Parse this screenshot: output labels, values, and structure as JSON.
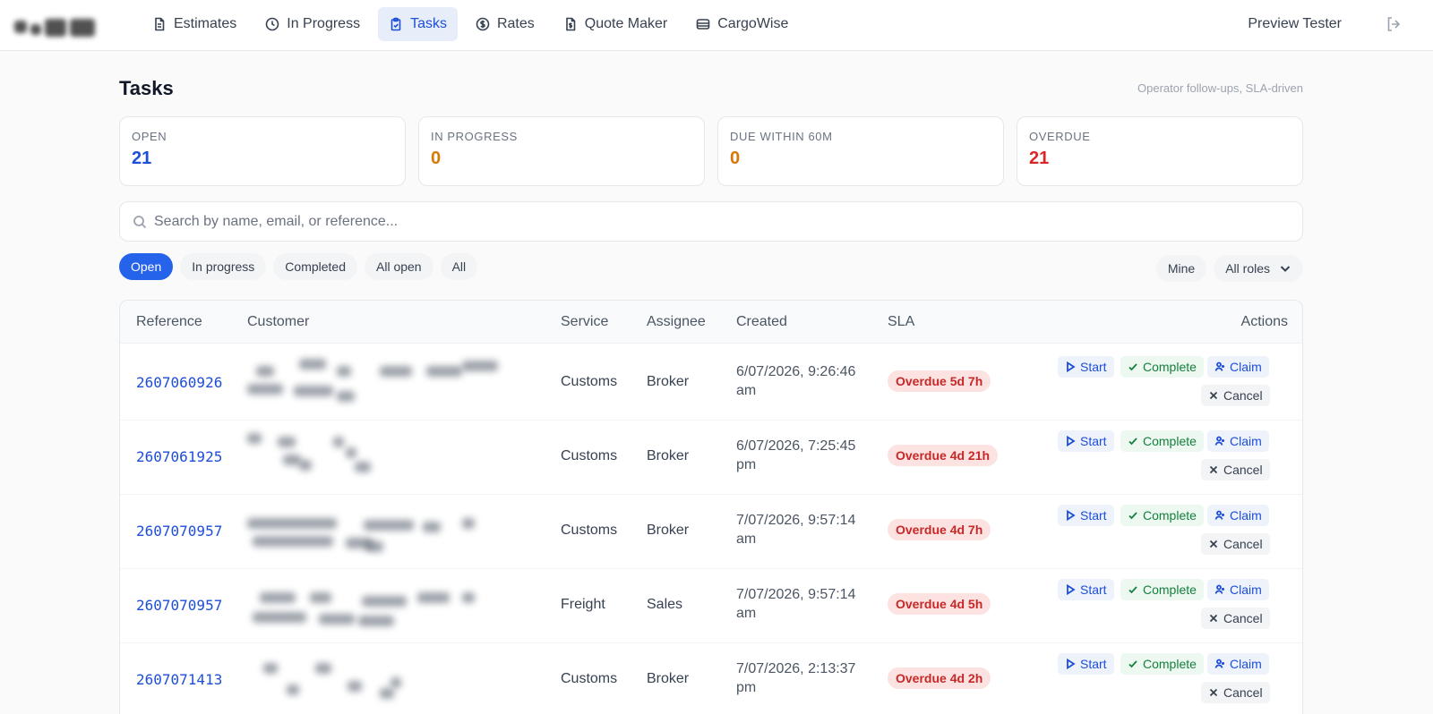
{
  "nav": {
    "items": [
      {
        "label": "Estimates",
        "icon": "document-icon",
        "active": false
      },
      {
        "label": "In Progress",
        "icon": "clock-icon",
        "active": false
      },
      {
        "label": "Tasks",
        "icon": "clipboard-icon",
        "active": true
      },
      {
        "label": "Rates",
        "icon": "dollar-icon",
        "active": false
      },
      {
        "label": "Quote Maker",
        "icon": "file-dollar-icon",
        "active": false
      },
      {
        "label": "CargoWise",
        "icon": "database-icon",
        "active": false
      }
    ],
    "user_name": "Preview Tester"
  },
  "page": {
    "title": "Tasks",
    "subtitle": "Operator follow-ups, SLA-driven"
  },
  "stats": [
    {
      "label": "OPEN",
      "value": "21",
      "color": "#1d4ed8"
    },
    {
      "label": "IN PROGRESS",
      "value": "0",
      "color": "#d97706"
    },
    {
      "label": "DUE WITHIN 60M",
      "value": "0",
      "color": "#d97706"
    },
    {
      "label": "OVERDUE",
      "value": "21",
      "color": "#dc2626"
    }
  ],
  "search": {
    "placeholder": "Search by name, email, or reference..."
  },
  "filters": {
    "status": [
      "Open",
      "In progress",
      "Completed",
      "All open",
      "All"
    ],
    "mine": "Mine",
    "roles": "All roles"
  },
  "table": {
    "headers": {
      "reference": "Reference",
      "customer": "Customer",
      "service": "Service",
      "assignee": "Assignee",
      "created": "Created",
      "sla": "SLA",
      "actions": "Actions"
    },
    "action_labels": {
      "start": "Start",
      "complete": "Complete",
      "claim": "Claim",
      "cancel": "Cancel"
    },
    "rows": [
      {
        "reference": "2607060926",
        "service": "Customs",
        "assignee": "Broker",
        "created": "6/07/2026, 9:26:46 am",
        "sla": "Overdue 5d 7h"
      },
      {
        "reference": "2607061925",
        "service": "Customs",
        "assignee": "Broker",
        "created": "6/07/2026, 7:25:45 pm",
        "sla": "Overdue 4d 21h"
      },
      {
        "reference": "2607070957",
        "service": "Customs",
        "assignee": "Broker",
        "created": "7/07/2026, 9:57:14 am",
        "sla": "Overdue 4d 7h"
      },
      {
        "reference": "2607070957",
        "service": "Freight",
        "assignee": "Sales",
        "created": "7/07/2026, 9:57:14 am",
        "sla": "Overdue 4d 5h"
      },
      {
        "reference": "2607071413",
        "service": "Customs",
        "assignee": "Broker",
        "created": "7/07/2026, 2:13:37 pm",
        "sla": "Overdue 4d 2h"
      }
    ]
  }
}
